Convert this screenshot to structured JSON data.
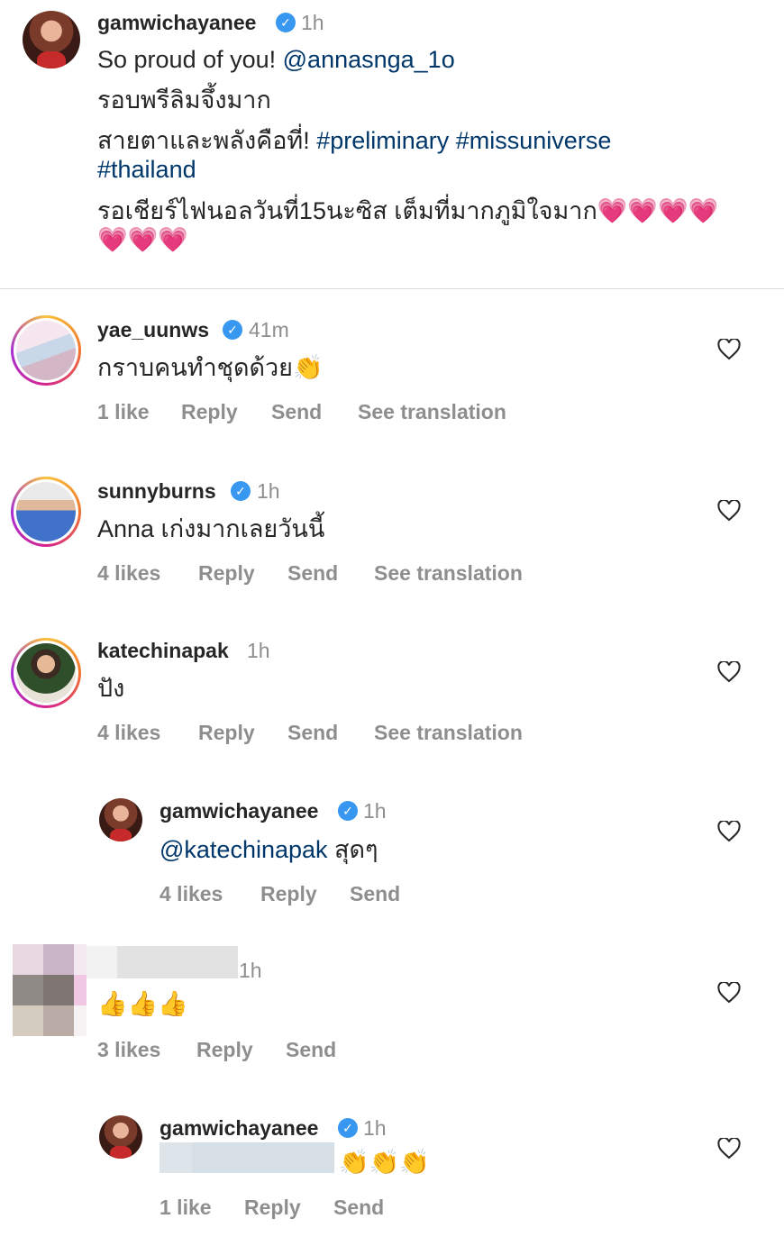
{
  "caption": {
    "username": "gamwichayanee",
    "time": "1h",
    "line1_text": "So proud of you! ",
    "line1_mention": "@annasnga_1o",
    "line2": "รอบพรีลิมจึ้งมาก",
    "line3_text": "สายตาและพลังคือที่! ",
    "line3_tags": "#preliminary #missuniverse",
    "line4_tag": "#thailand",
    "line5_text": "รอเชียร์ไฟนอลวันที่15นะซิส เต็มที่มากภูมิใจมาก",
    "line5_emoji": "💗💗💗💗",
    "line6_emoji": "💗💗💗"
  },
  "comments": [
    {
      "username": "yae_uunws",
      "time": "41m",
      "text": "กราบคนทำชุดด้วย👏",
      "likes": "1 like",
      "reply": "Reply",
      "send": "Send",
      "translate": "See translation"
    },
    {
      "username": "sunnyburns",
      "time": "1h",
      "text": "Anna เก่งมากเลยวันนี้",
      "likes": "4 likes",
      "reply": "Reply",
      "send": "Send",
      "translate": "See translation"
    },
    {
      "username": "katechinapak",
      "time": "1h",
      "text": "ปัง",
      "likes": "4 likes",
      "reply": "Reply",
      "send": "Send",
      "translate": "See translation"
    },
    {
      "username": "gamwichayanee",
      "time": "1h",
      "mention": "@katechinapak",
      "text": " สุดๆ",
      "likes": "4 likes",
      "reply": "Reply",
      "send": "Send"
    },
    {
      "username": "",
      "time": "1h",
      "text": "👍👍👍",
      "likes": "3 likes",
      "reply": "Reply",
      "send": "Send"
    },
    {
      "username": "gamwichayanee",
      "time": "1h",
      "text": "👏👏👏",
      "likes": "1 like",
      "reply": "Reply",
      "send": "Send"
    }
  ],
  "icons": {
    "verified": "verified-badge-icon",
    "heart": "heart-outline-icon"
  },
  "colors": {
    "link": "#00376b",
    "verified": "#3897f0",
    "muted": "#8e8e8e"
  }
}
